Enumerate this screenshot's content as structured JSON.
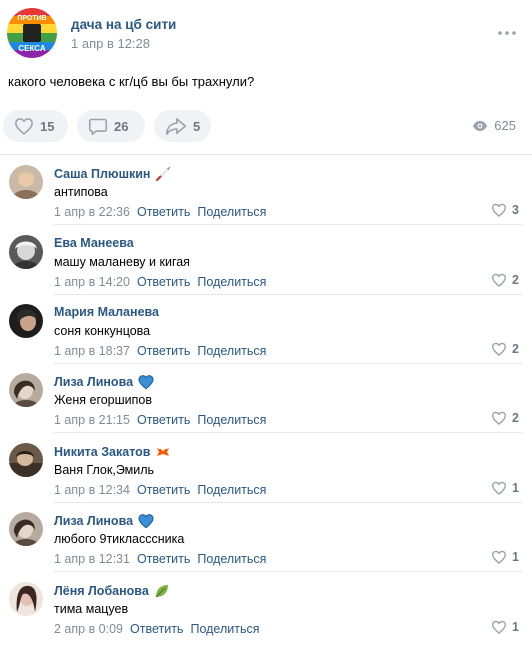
{
  "post": {
    "group_name": "дача на цб сити",
    "avatar_text_top": "ПРОТИВ",
    "avatar_text_bottom": "СЕКСА",
    "date": "1 апр в 12:28",
    "text": "какого человека с кг/цб вы бы трахнули?",
    "likes": "15",
    "comments": "26",
    "shares": "5",
    "views": "625"
  },
  "comments": [
    {
      "author": "Саша Плюшкин",
      "badge": "syringe-icon",
      "text": "антипова",
      "date": "1 апр в 22:36",
      "reply": "Ответить",
      "share": "Поделиться",
      "likes": "3"
    },
    {
      "author": "Ева Манеева",
      "badge": "",
      "text": "машу маланеву и кигая",
      "date": "1 апр в 14:20",
      "reply": "Ответить",
      "share": "Поделиться",
      "likes": "2"
    },
    {
      "author": "Мария Маланева",
      "badge": "",
      "text": "соня конкунцова",
      "date": "1 апр в 18:37",
      "reply": "Ответить",
      "share": "Поделиться",
      "likes": "2"
    },
    {
      "author": "Лиза Линова",
      "badge": "blue-heart-icon",
      "text": "Женя егоршипов",
      "date": "1 апр в 21:15",
      "reply": "Ответить",
      "share": "Поделиться",
      "likes": "2"
    },
    {
      "author": "Никита Закатов",
      "badge": "fnatic-icon",
      "text": "Ваня Глок,Эмиль",
      "date": "1 апр в 12:34",
      "reply": "Ответить",
      "share": "Поделиться",
      "likes": "1"
    },
    {
      "author": "Лиза Линова",
      "badge": "blue-heart-icon",
      "text": "любого 9тикласссника",
      "date": "1 апр в 12:31",
      "reply": "Ответить",
      "share": "Поделиться",
      "likes": "1"
    },
    {
      "author": "Лёня Лобанова",
      "badge": "leaf-icon",
      "text": "тима мацуев",
      "date": "2 апр в 0:09",
      "reply": "Ответить",
      "share": "Поделиться",
      "likes": "1"
    }
  ],
  "colors": {
    "link": "#2a5885",
    "muted": "#818c99",
    "pill_bg": "#f0f2f5",
    "divider": "#e7e8ec"
  }
}
